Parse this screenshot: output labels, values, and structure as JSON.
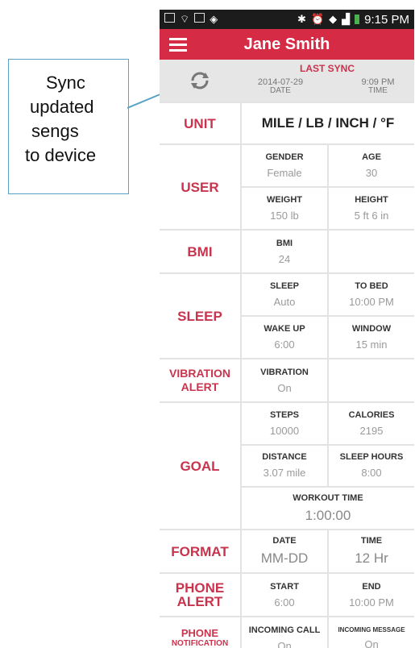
{
  "callout": {
    "lines": [
      "Sync",
      "updated",
      "sengs",
      "to device"
    ]
  },
  "status_bar": {
    "time": "9:15 PM"
  },
  "app_bar": {
    "title": "Jane Smith",
    "menu_icon": "hamburger-menu-icon"
  },
  "sync": {
    "icon": "sync-icon",
    "heading": "LAST SYNC",
    "date_value": "2014-07-29",
    "date_label": "DATE",
    "time_value": "9:09 PM",
    "time_label": "TIME"
  },
  "unit": {
    "label": "UNIT",
    "value": "MILE / LB / INCH / °F"
  },
  "user": {
    "label": "USER",
    "gender_label": "GENDER",
    "gender": "Female",
    "age_label": "AGE",
    "age": "30",
    "weight_label": "WEIGHT",
    "weight": "150 lb",
    "height_label": "HEIGHT",
    "height": "5 ft 6 in"
  },
  "bmi": {
    "label": "BMI",
    "key": "BMI",
    "value": "24"
  },
  "sleep": {
    "label": "SLEEP",
    "sleep_label": "SLEEP",
    "sleep": "Auto",
    "to_bed_label": "TO BED",
    "to_bed": "10:00 PM",
    "wake_up_label": "WAKE UP",
    "wake_up": "6:00",
    "window_label": "WINDOW",
    "window": "15 min"
  },
  "vibration": {
    "label_line1": "VIBRATION",
    "label_line2": "ALERT",
    "key": "VIBRATION",
    "value": "On"
  },
  "goal": {
    "label": "GOAL",
    "steps_label": "STEPS",
    "steps": "10000",
    "calories_label": "CALORIES",
    "calories": "2195",
    "distance_label": "DISTANCE",
    "distance": "3.07 mile",
    "sleep_hours_label": "SLEEP HOURS",
    "sleep_hours": "8:00",
    "workout_label": "WORKOUT TIME",
    "workout": "1:00:00"
  },
  "format": {
    "label": "FORMAT",
    "date_label": "DATE",
    "date": "MM-DD",
    "time_label": "TIME",
    "time": "12 Hr"
  },
  "phone_alert": {
    "label_line1": "PHONE",
    "label_line2": "ALERT",
    "start_label": "START",
    "start": "6:00",
    "end_label": "END",
    "end": "10:00 PM"
  },
  "phone_notification": {
    "label_line1": "PHONE",
    "label_line2": "NOTIFICATION",
    "incoming_call_label": "INCOMING CALL",
    "incoming_call": "On",
    "incoming_message_label": "INCOMING MESSAGE",
    "incoming_message": "On"
  },
  "colors": {
    "accent": "#d62b45",
    "label_text": "#c8344d",
    "callout_border": "#5aa2c6"
  }
}
